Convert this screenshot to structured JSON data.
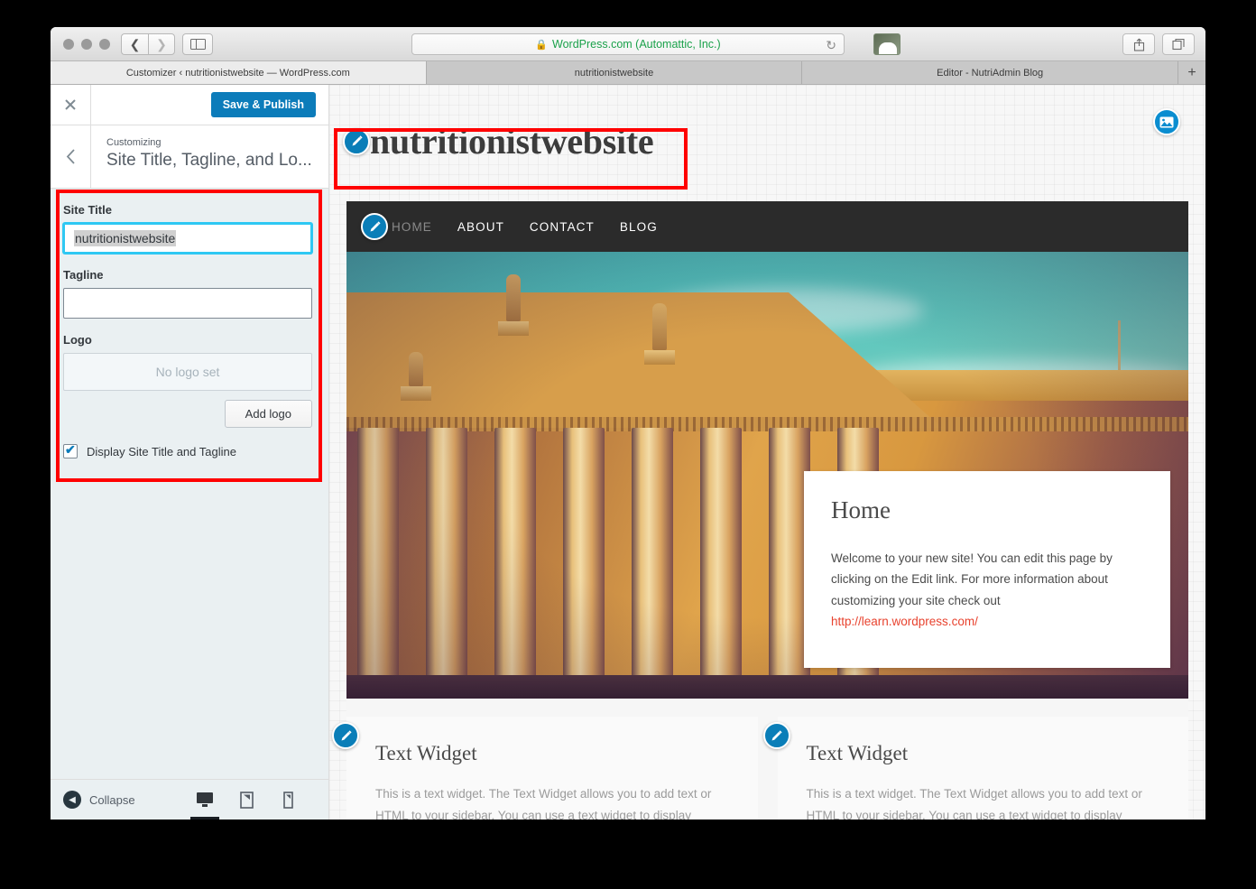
{
  "browser": {
    "url_text": "WordPress.com (Automattic, Inc.)",
    "lock_icon": "lock-icon",
    "reload_icon": "reload-icon",
    "back_icon": "chevron-left-icon",
    "forward_icon": "chevron-right-icon",
    "sidebar_icon": "sidebar-toggle-icon",
    "share_icon": "share-icon",
    "tabs_icon": "tab-overview-icon",
    "new_tab_label": "+",
    "tabs": [
      {
        "label": "Customizer ‹ nutritionistwebsite — WordPress.com",
        "active": true
      },
      {
        "label": "nutritionistwebsite",
        "active": false
      },
      {
        "label": "Editor - NutriAdmin Blog",
        "active": false
      }
    ]
  },
  "customizer": {
    "close_icon": "close-icon",
    "save_label": "Save & Publish",
    "back_icon": "chevron-left-icon",
    "breadcrumb_label": "Customizing",
    "panel_title": "Site Title, Tagline, and Lo...",
    "controls": {
      "site_title_label": "Site Title",
      "site_title_value": "nutritionistwebsite",
      "tagline_label": "Tagline",
      "tagline_value": "",
      "tagline_placeholder": "",
      "logo_label": "Logo",
      "no_logo_text": "No logo set",
      "add_logo_label": "Add logo",
      "display_checkbox_label": "Display Site Title and Tagline",
      "display_checkbox_checked": "true"
    },
    "footer": {
      "collapse_label": "Collapse",
      "collapse_icon": "collapse-arrow-icon",
      "devices": [
        {
          "name": "desktop-preview-icon",
          "active": true
        },
        {
          "name": "tablet-preview-icon",
          "active": false
        },
        {
          "name": "mobile-preview-icon",
          "active": false
        }
      ]
    }
  },
  "preview": {
    "site_title": "nutritionistwebsite",
    "title_edit_icon": "edit-pencil-icon",
    "media_edit_icon": "image-edit-icon",
    "nav": [
      {
        "label": "HOME",
        "dim": true
      },
      {
        "label": "ABOUT",
        "dim": false
      },
      {
        "label": "CONTACT",
        "dim": false
      },
      {
        "label": "BLOG",
        "dim": false
      }
    ],
    "nav_edit_icon": "edit-pencil-icon",
    "home_card": {
      "heading": "Home",
      "body_before_link": "Welcome to your new site! You can edit this page by clicking on the Edit link. For more information about customizing your site check out ",
      "link_text": "http://learn.wordpress.com/"
    },
    "widgets": [
      {
        "edit_icon": "edit-pencil-icon",
        "title": "Text Widget",
        "body": "This is a text widget. The Text Widget allows you to add text or HTML to your sidebar. You can use a text widget to display"
      },
      {
        "edit_icon": "edit-pencil-icon",
        "title": "Text Widget",
        "body": "This is a text widget. The Text Widget allows you to add text or HTML to your sidebar. You can use a text widget to display"
      }
    ]
  },
  "annotations": {
    "highlight_color": "#ff0000",
    "boxes": [
      "site-title-preview-highlight",
      "customizer-controls-highlight"
    ]
  },
  "colors": {
    "accent_blue": "#0c7cba",
    "focus_cyan": "#2ec8f3",
    "link_red": "#e8432f",
    "navbar_dark": "#2b2b2b"
  }
}
